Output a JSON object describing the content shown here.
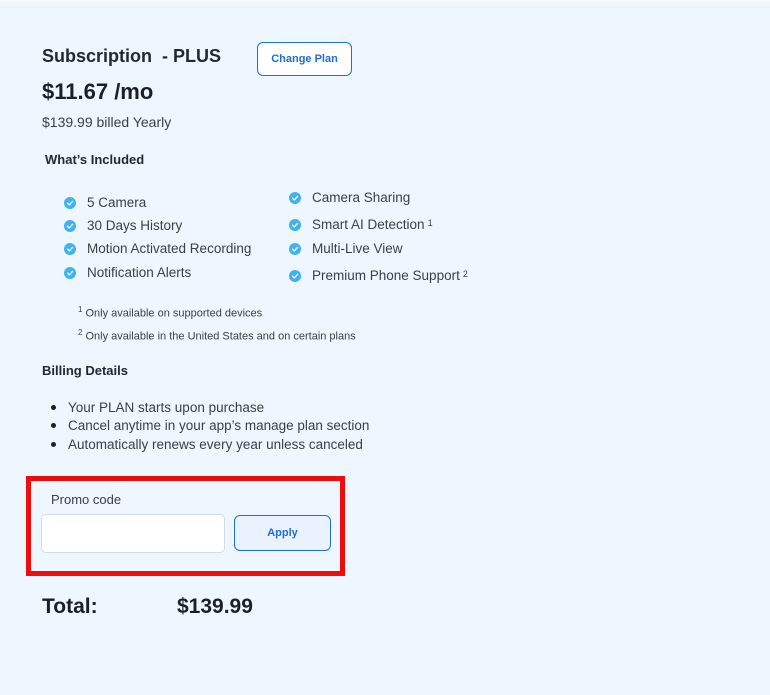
{
  "plan": {
    "title": "Subscription  - PLUS",
    "change_plan_label": "Change Plan",
    "price": "$11.67 /mo",
    "billed": "$139.99 billed Yearly"
  },
  "included": {
    "heading": "What’s Included",
    "left": [
      {
        "label": "5 Camera",
        "sup": ""
      },
      {
        "label": "30 Days History",
        "sup": ""
      },
      {
        "label": "Motion Activated Recording",
        "sup": ""
      },
      {
        "label": "Notification Alerts",
        "sup": ""
      }
    ],
    "right": [
      {
        "label": "Camera Sharing",
        "sup": ""
      },
      {
        "label": "Smart AI Detection",
        "sup": "1"
      },
      {
        "label": "Multi-Live View",
        "sup": ""
      },
      {
        "label": "Premium Phone Support",
        "sup": "2"
      }
    ],
    "footnotes": [
      {
        "mark": "1",
        "text": "Only available on supported devices"
      },
      {
        "mark": "2",
        "text": "Only available in the United States and on certain plans"
      }
    ]
  },
  "billing": {
    "heading": "Billing Details",
    "items": [
      "Your PLAN starts upon purchase",
      "Cancel anytime in your app’s manage plan section",
      "Automatically renews every year unless canceled"
    ]
  },
  "promo": {
    "label": "Promo code",
    "value": "",
    "placeholder": "",
    "apply_label": "Apply"
  },
  "total": {
    "label": "Total:",
    "value": "$139.99"
  },
  "colors": {
    "accent": "#1d6fd6",
    "check": "#3fb3ef",
    "highlight": "#ee0d0d",
    "background": "#eef6ff"
  }
}
